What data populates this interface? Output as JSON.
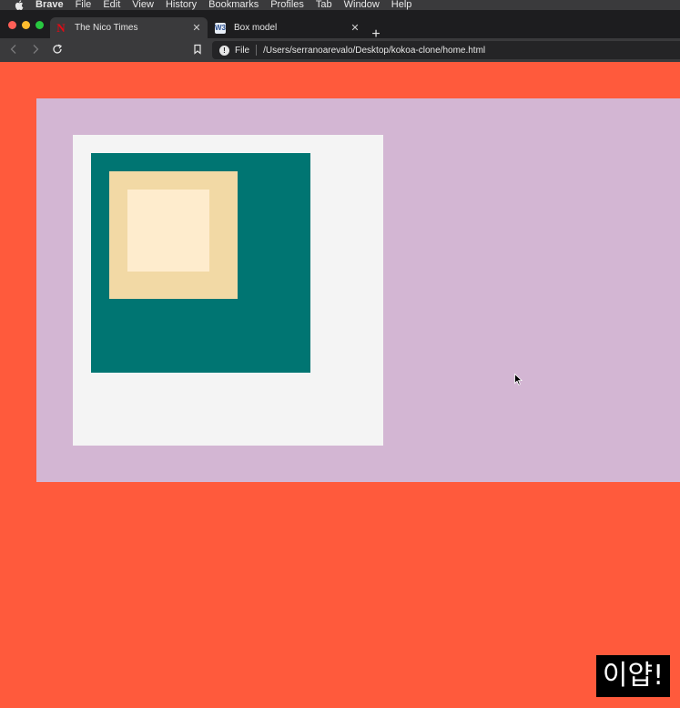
{
  "menubar": {
    "apple_icon": "apple-logo-icon",
    "app_name": "Brave",
    "items": [
      "File",
      "Edit",
      "View",
      "History",
      "Bookmarks",
      "Profiles",
      "Tab",
      "Window",
      "Help"
    ]
  },
  "tabs": [
    {
      "title": "The Nico Times",
      "favicon": "N",
      "active": true
    },
    {
      "title": "Box model",
      "favicon": "W3",
      "active": false
    }
  ],
  "toolbar": {
    "scheme_label": "File",
    "url": "/Users/serranoarevalo/Desktop/kokoa-clone/home.html"
  },
  "caption": {
    "text": "이얍!"
  },
  "colors": {
    "page_background": "#ff5a3c",
    "outer_box": "#d3b6d3",
    "white_box": "#f4f4f4",
    "teal_box": "#007572",
    "tan_box": "#f2d9a5",
    "cream_box": "#feeccd"
  }
}
